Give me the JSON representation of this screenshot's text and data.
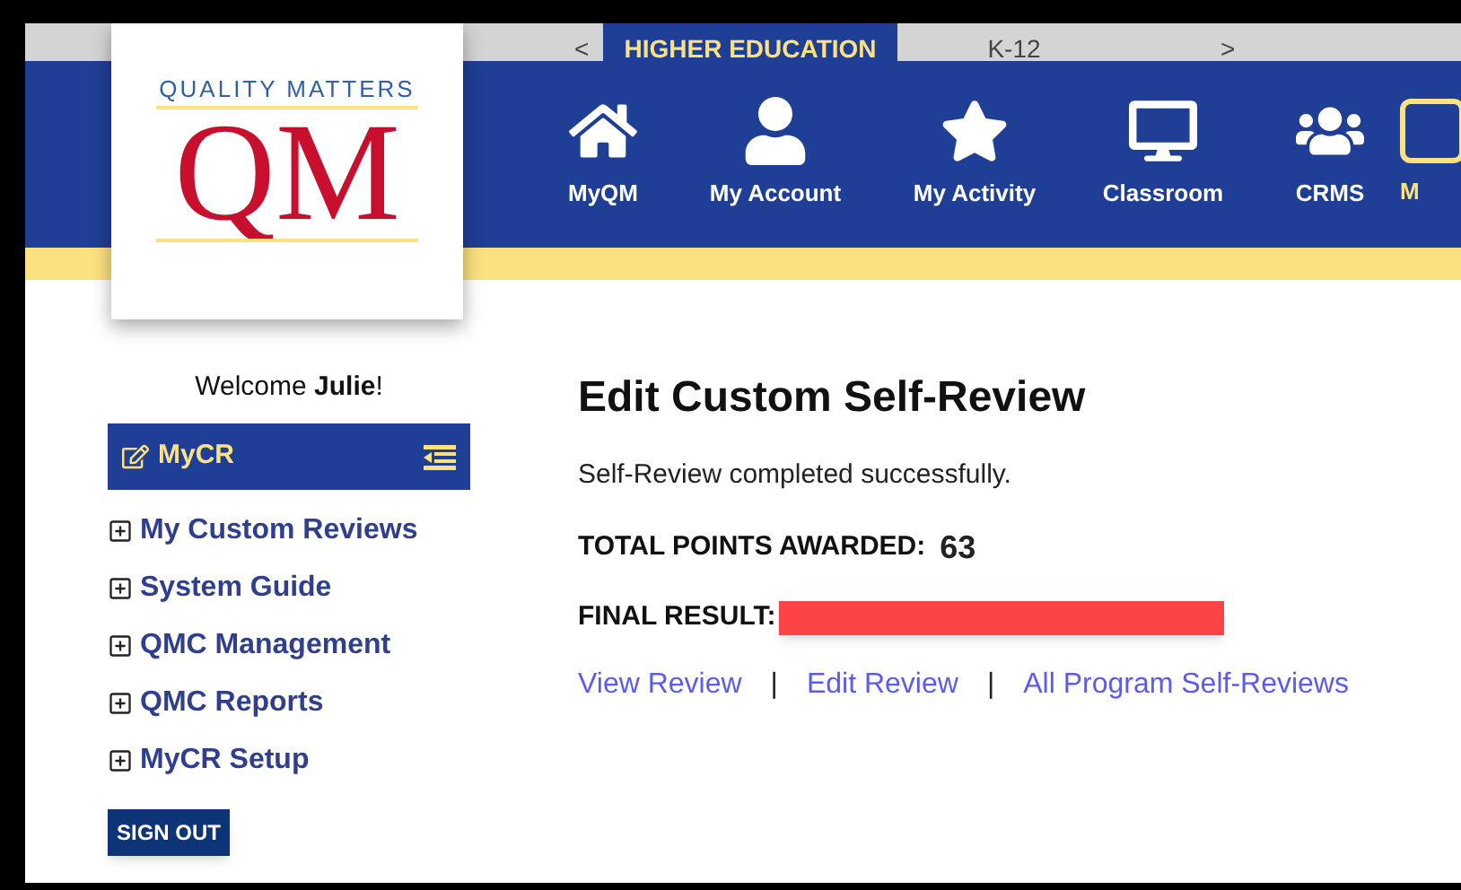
{
  "top_tabs": {
    "prev": "<",
    "next": ">",
    "tabs": [
      {
        "label": "HIGHER EDUCATION",
        "selected": true
      },
      {
        "label": "K-12",
        "selected": false
      }
    ]
  },
  "logo": {
    "tagline": "QUALITY MATTERS",
    "mark": "QM"
  },
  "nav": [
    {
      "label": "MyQM",
      "kind": "home",
      "selected": false
    },
    {
      "label": "My Account",
      "kind": "user",
      "selected": false
    },
    {
      "label": "My Activity",
      "kind": "star",
      "selected": false
    },
    {
      "label": "Classroom",
      "kind": "monitor",
      "selected": false
    },
    {
      "label": "CRMS",
      "kind": "users",
      "selected": false
    },
    {
      "label": "M",
      "kind": "box",
      "selected": true
    }
  ],
  "sidebar": {
    "welcome": "Welcome **Julie**!",
    "panel_title": "MyCR",
    "items": [
      {
        "label": "My Custom Reviews",
        "expanded": false
      },
      {
        "label": "System Guide",
        "expanded": false
      },
      {
        "label": "QMC Management",
        "expanded": false
      },
      {
        "label": "QMC Reports",
        "expanded": false
      },
      {
        "label": "MyCR Setup",
        "expanded": false
      }
    ],
    "sign_out": "SIGN OUT"
  },
  "main": {
    "title": "Edit Custom Self-Review",
    "message": "Self-Review completed successfully.",
    "points_label": "TOTAL POINTS AWARDED:",
    "points": "63",
    "result_label": "FINAL RESULT:",
    "result_redacted": true,
    "links": [
      "View Review",
      "Edit Review",
      "All Program Self-Reviews"
    ],
    "separator": "|"
  }
}
